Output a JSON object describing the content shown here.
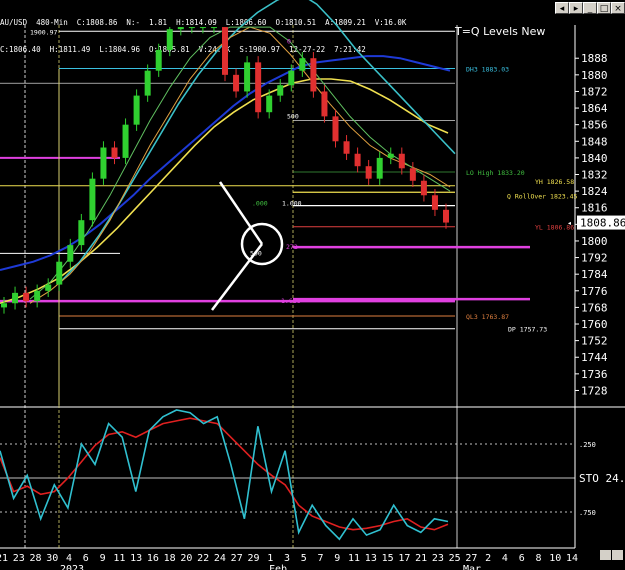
{
  "header": {
    "line1": "AU/USD  480-Min  C:1808.86  N:-  1.81  H:1814.09  L:1806.60  O:1810.51  A:1809.21  V:16.0K",
    "line2": "C:1806.40  H:1811.49  L:1804.96  O:1805.81  V:24.1K  S:1900.97  12-27-22  7:21:42"
  },
  "window_buttons": [
    "◂",
    "▸",
    "_",
    "□",
    "×"
  ],
  "chart_data": [
    {
      "type": "candlestick",
      "title": "T=Q Levels New",
      "symbol": "AU/USD",
      "timeframe": "480-Min",
      "last_price": "1808.86",
      "y_ticks": [
        1888,
        1880,
        1872,
        1864,
        1856,
        1848,
        1840,
        1832,
        1824,
        1816,
        1808,
        1800,
        1792,
        1784,
        1776,
        1768,
        1760,
        1752,
        1744,
        1736,
        1728
      ],
      "ylim": [
        1721,
        1904
      ],
      "x_tick_labels": [
        "21",
        "23",
        "28",
        "30",
        "4",
        "6",
        "9",
        "11",
        "13",
        "16",
        "18",
        "20",
        "22",
        "24",
        "27",
        "29",
        "1",
        "3",
        "5",
        "7",
        "9",
        "11",
        "13",
        "15",
        "17",
        "21",
        "23",
        "25",
        "27",
        "2",
        "4",
        "6",
        "8",
        "10",
        "14"
      ],
      "x_axis_bottom": [
        "2023",
        "Feb",
        "Mar"
      ],
      "level_labels": [
        {
          "text": "1900.97",
          "price": 1900.97
        },
        {
          "text": "DH3 1883.03",
          "price": 1883.03
        },
        {
          "text": "LO High 1833.20",
          "price": 1833.2
        },
        {
          "text": "YH 1826.58",
          "price": 1826.58
        },
        {
          "text": "Q RollOver 1823.45",
          "price": 1823.45
        },
        {
          "text": "YL 1806.86",
          "price": 1806.86
        },
        {
          "text": "QL3 1763.87",
          "price": 1763.87
        },
        {
          "text": "DP 1757.73",
          "price": 1757.73
        }
      ],
      "fib_labels": [
        "0",
        "500",
        "1.000",
        ".000",
        "500",
        "272",
        "1.618"
      ],
      "candles_approx_close": [
        1770,
        1775,
        1771,
        1776,
        1779,
        1790,
        1798,
        1810,
        1830,
        1845,
        1840,
        1856,
        1870,
        1882,
        1892,
        1902,
        1910,
        1922,
        1930,
        1934,
        1880,
        1872,
        1886,
        1862,
        1870,
        1875,
        1882,
        1888,
        1872,
        1860,
        1848,
        1842,
        1836,
        1830,
        1840,
        1842,
        1835,
        1829,
        1822,
        1815,
        1808.86
      ],
      "overlays": [
        {
          "name": "",
          "color": "#1e3ad6",
          "values": [
            1786,
            1788,
            1790,
            1793,
            1797,
            1802,
            1808,
            1815,
            1822,
            1830,
            1837,
            1844,
            1851,
            1858,
            1865,
            1871,
            1876,
            1880,
            1884,
            1886,
            1887,
            1888,
            1889,
            1889,
            1888,
            1886,
            1884,
            1882
          ]
        },
        {
          "name": "",
          "color": "#f0e050",
          "values": [
            1770,
            1773,
            1777,
            1782,
            1789,
            1797,
            1806,
            1816,
            1826,
            1836,
            1846,
            1855,
            1862,
            1868,
            1872,
            1876,
            1878,
            1878,
            1877,
            1873,
            1868,
            1862,
            1856,
            1852
          ]
        },
        {
          "name": "",
          "color": "#3ac0c8",
          "values": [
            1780,
            1790,
            1803,
            1818,
            1834,
            1850,
            1866,
            1880,
            1892,
            1902,
            1910,
            1916,
            1920,
            1914,
            1904,
            1892,
            1882,
            1872,
            1862,
            1852,
            1842
          ]
        }
      ],
      "oscillator": {
        "name": "STO",
        "value_label": "STO  24.",
        "levels": [
          ".250",
          ".750"
        ],
        "k": [
          70,
          35,
          52,
          20,
          45,
          28,
          75,
          60,
          90,
          80,
          40,
          85,
          95,
          100,
          98,
          90,
          95,
          60,
          20,
          88,
          40,
          70,
          10,
          30,
          15,
          5,
          20,
          8,
          12,
          30,
          15,
          10,
          20,
          18
        ],
        "d": [
          65,
          40,
          44,
          38,
          40,
          50,
          62,
          74,
          82,
          84,
          80,
          85,
          90,
          92,
          94,
          92,
          90,
          80,
          70,
          60,
          52,
          45,
          30,
          22,
          18,
          14,
          12,
          13,
          15,
          18,
          20,
          14,
          12,
          16
        ]
      }
    }
  ]
}
